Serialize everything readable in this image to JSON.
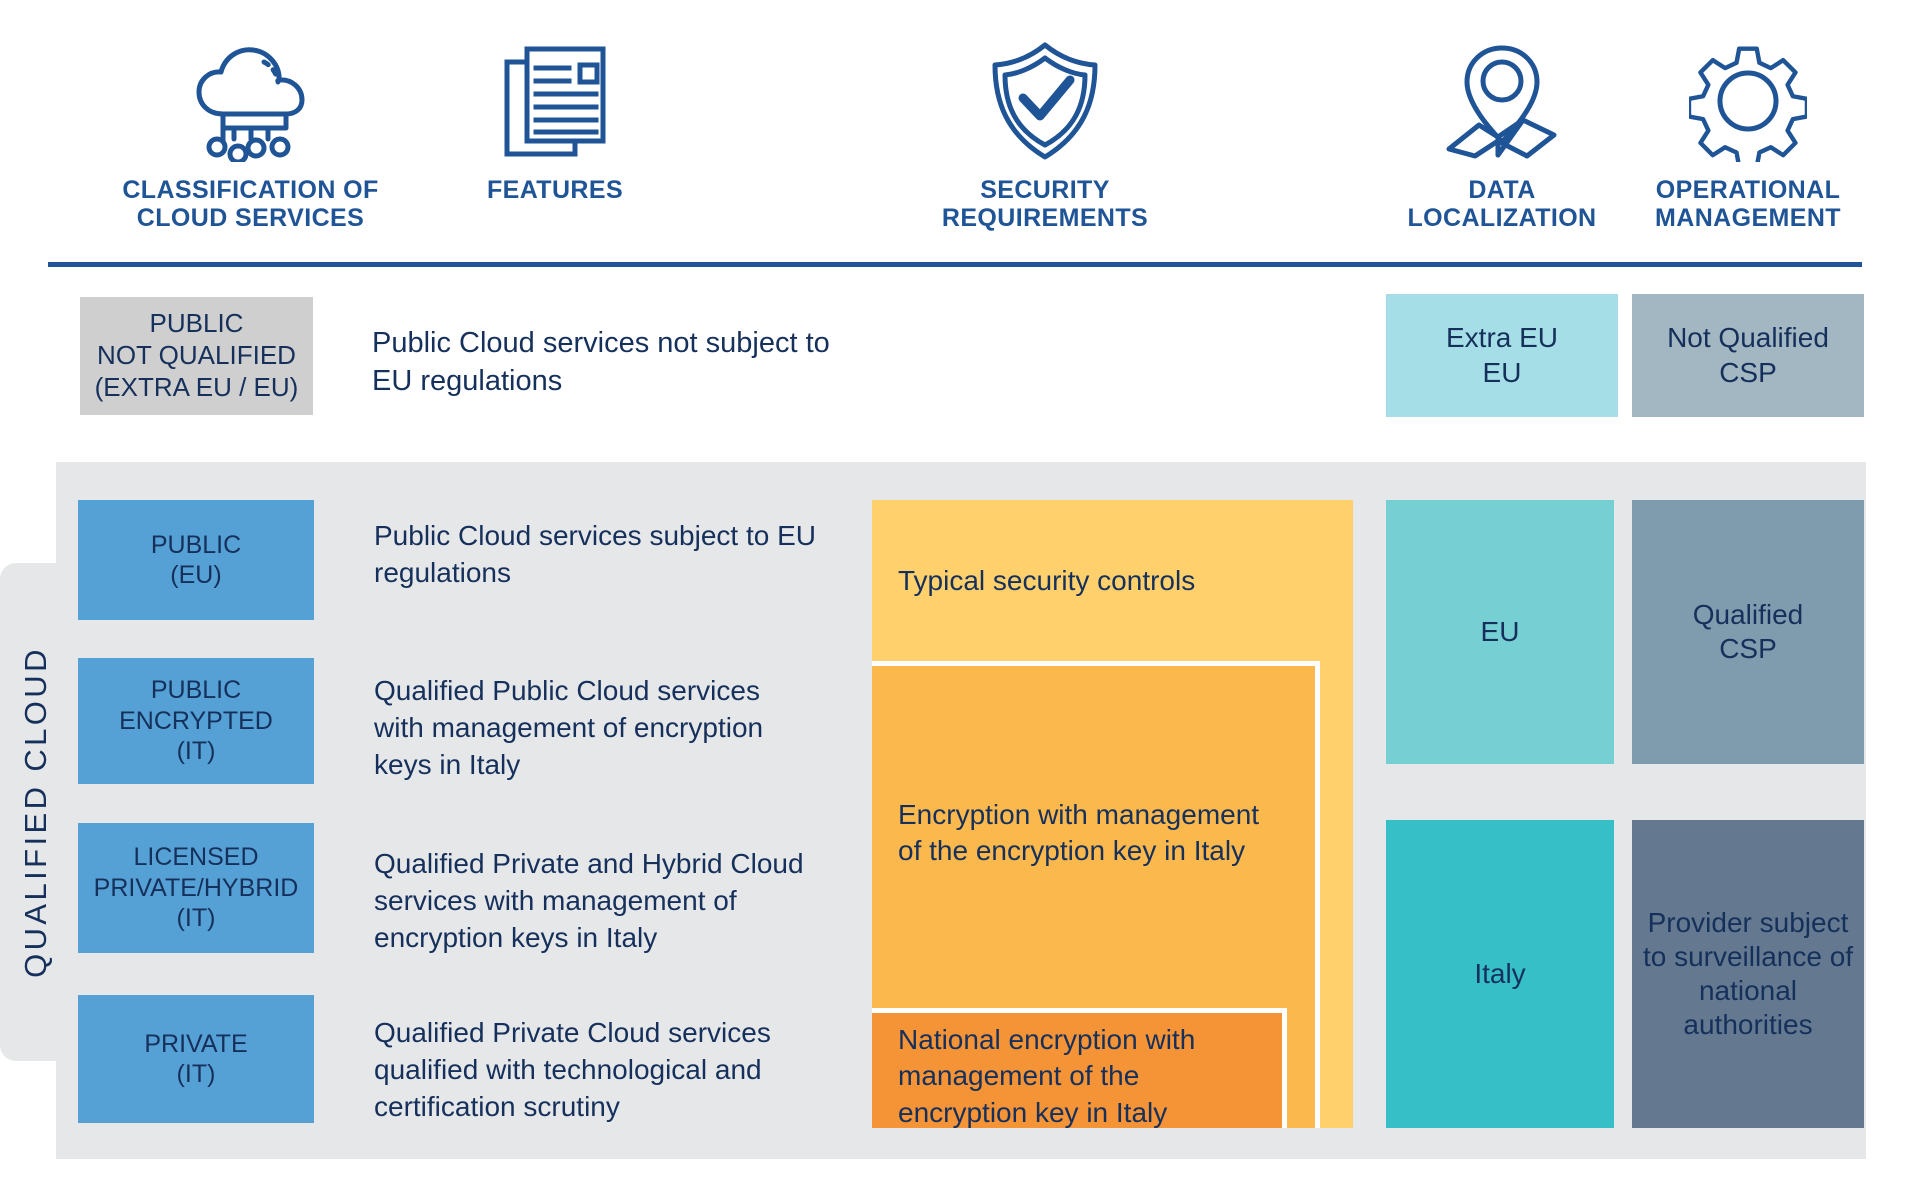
{
  "header": {
    "columns": [
      {
        "icon": "cloud-network-icon",
        "label": "CLASSIFICATION OF\nCLOUD SERVICES"
      },
      {
        "icon": "documents-icon",
        "label": "FEATURES"
      },
      {
        "icon": "shield-check-icon",
        "label": "SECURITY\nREQUIREMENTS"
      },
      {
        "icon": "map-pin-icon",
        "label": "DATA\nLOCALIZATION"
      },
      {
        "icon": "gear-icon",
        "label": "OPERATIONAL\nMANAGEMENT"
      }
    ]
  },
  "not_qualified_row": {
    "classification": "PUBLIC\nNOT QUALIFIED\n(EXTRA EU / EU)",
    "features": "Public Cloud services not subject to\nEU regulations",
    "data_localization": "Extra EU\nEU",
    "operational_management": "Not Qualified\nCSP"
  },
  "qualified_section": {
    "side_label": "QUALIFIED CLOUD",
    "rows": [
      {
        "classification": "PUBLIC\n(EU)",
        "features": "Public Cloud services subject to EU\nregulations"
      },
      {
        "classification": "PUBLIC\nENCRYPTED\n(IT)",
        "features": "Qualified Public Cloud services\nwith management of encryption\nkeys in Italy"
      },
      {
        "classification": "LICENSED\nPRIVATE/HYBRID\n(IT)",
        "features": "Qualified Private and Hybrid Cloud\nservices with management of\nencryption keys in Italy"
      },
      {
        "classification": "PRIVATE\n(IT)",
        "features": "Qualified Private Cloud services\nqualified with technological and\ncertification scrutiny"
      }
    ],
    "security_requirements": {
      "outer": "Typical security controls",
      "middle": "Encryption with management\nof the encryption key in Italy",
      "inner": "National encryption with\nmanagement of the\nencryption key in Italy"
    },
    "data_localization": {
      "upper": "EU",
      "lower": "Italy"
    },
    "operational_management": {
      "upper": "Qualified\nCSP",
      "lower": "Provider subject\nto surveillance of\nnational\nauthorities"
    }
  },
  "colors": {
    "brand_blue": "#1F5496",
    "text_navy": "#16305C",
    "panel_gray": "#E6E7E8",
    "tag_gray": "#CFCFCF",
    "tag_blue": "#55A0D4",
    "cyan_light": "#A5DEE6",
    "cyan_mid": "#76CFD3",
    "cyan_strong": "#37BFC8",
    "slate_light": "#A2B7C2",
    "slate_mid": "#7F9BAE",
    "slate_dark": "#64798F",
    "orange_light": "#FFD06B",
    "orange_mid": "#FBB84D",
    "orange_dark": "#F59337"
  }
}
